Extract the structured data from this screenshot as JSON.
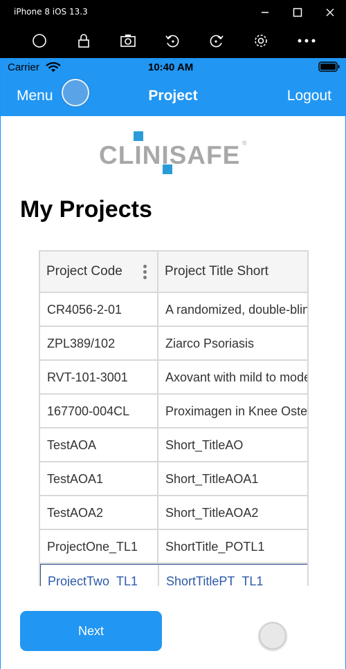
{
  "window": {
    "title": "iPhone 8 iOS 13.3"
  },
  "toolbar": {
    "icons": [
      "home-icon",
      "lock-icon",
      "screenshot-icon",
      "rotate-left-icon",
      "rotate-right-icon",
      "settings-icon",
      "more-icon"
    ]
  },
  "status_bar": {
    "carrier": "Carrier",
    "time": "10:40 AM"
  },
  "nav": {
    "menu_label": "Menu",
    "title": "Project",
    "logout_label": "Logout"
  },
  "logo": {
    "text": "CLINISAFE",
    "registered": "®",
    "accent_color": "#2a9bd8"
  },
  "page": {
    "heading": "My Projects"
  },
  "grid": {
    "columns": [
      "Project Code",
      "Project Title Short"
    ],
    "rows": [
      [
        "CR4056-2-01",
        "A randomized, double-blind"
      ],
      [
        "ZPL389/102",
        "Ziarco Psoriasis"
      ],
      [
        "RVT-101-3001",
        "Axovant with mild to moderate"
      ],
      [
        "167700-004CL",
        "Proximagen in Knee Osteoarthritis"
      ],
      [
        "TestAOA",
        "Short_TitleAO"
      ],
      [
        "TestAOA1",
        "Short_TitleAOA1"
      ],
      [
        "TestAOA2",
        "Short_TitleAOA2"
      ],
      [
        "ProjectOne_TL1",
        "ShortTitle_POTL1"
      ],
      [
        "ProjectTwo_TL1",
        "ShortTitlePT_TL1"
      ]
    ],
    "selected_row": 8
  },
  "actions": {
    "next_label": "Next"
  },
  "colors": {
    "primary": "#2196f3",
    "selected_text": "#2b5aa8"
  }
}
